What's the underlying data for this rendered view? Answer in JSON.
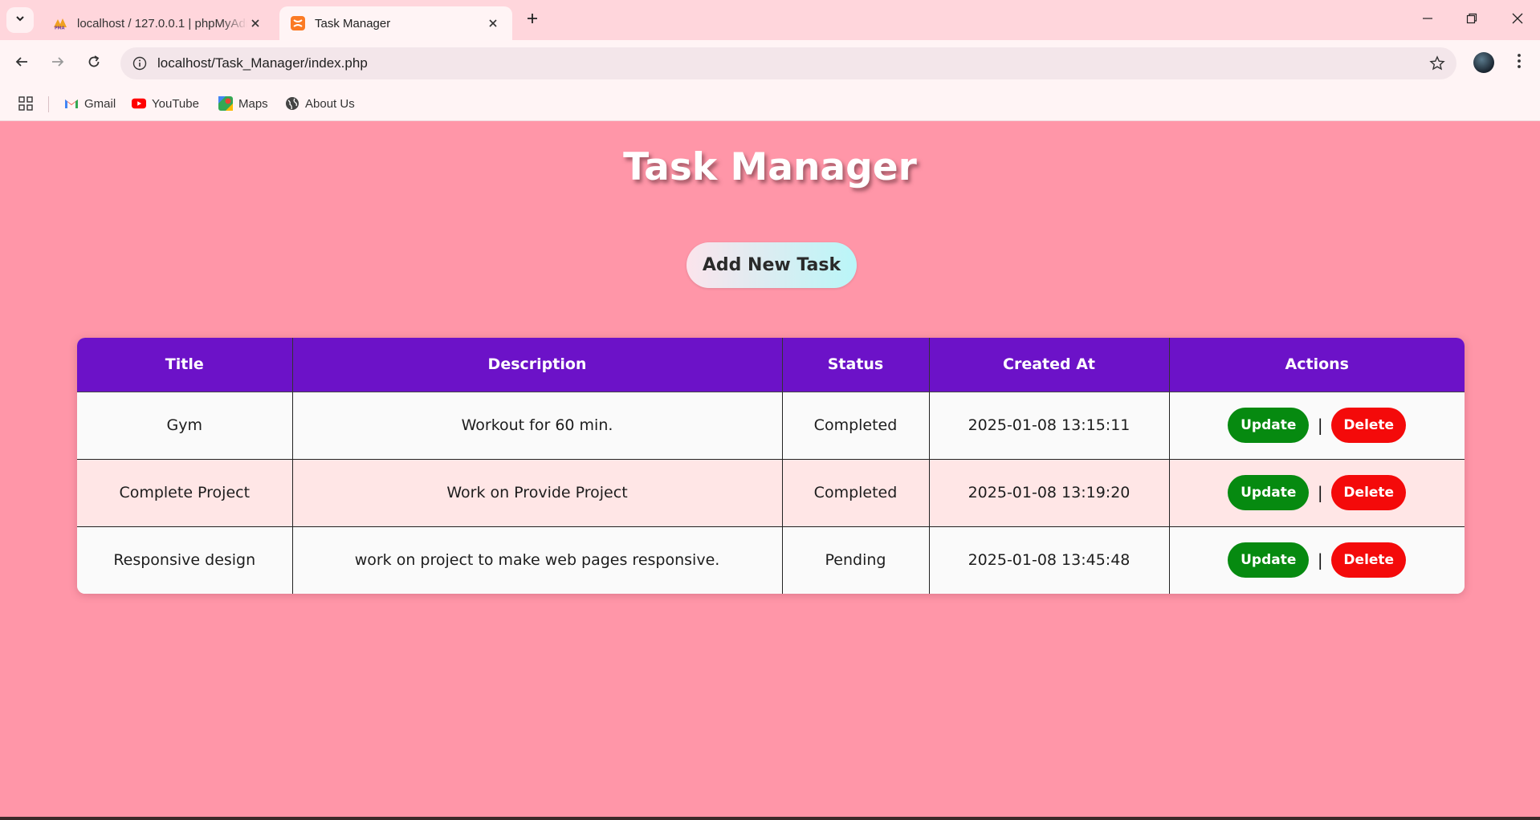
{
  "browser": {
    "tabs": [
      {
        "title": "localhost / 127.0.0.1 | phpMyAdmin",
        "active": false
      },
      {
        "title": "Task Manager",
        "active": true
      }
    ],
    "url": "localhost/Task_Manager/index.php",
    "bookmarks": [
      {
        "label": "Gmail",
        "icon": "gmail-icon"
      },
      {
        "label": "YouTube",
        "icon": "youtube-icon"
      },
      {
        "label": "Maps",
        "icon": "maps-icon"
      },
      {
        "label": "About Us",
        "icon": "globe-icon"
      }
    ]
  },
  "page": {
    "title": "Task Manager",
    "add_button": "Add New Task"
  },
  "table": {
    "headers": [
      "Title",
      "Description",
      "Status",
      "Created At",
      "Actions"
    ],
    "rows": [
      {
        "title": "Gym",
        "description": "Workout for 60 min.",
        "status": "Completed",
        "created_at": "2025-01-08 13:15:11"
      },
      {
        "title": "Complete Project",
        "description": "Work on Provide Project",
        "status": "Completed",
        "created_at": "2025-01-08 13:19:20"
      },
      {
        "title": "Responsive design",
        "description": "work on project to make web pages responsive.",
        "status": "Pending",
        "created_at": "2025-01-08 13:45:48"
      }
    ],
    "actions": {
      "update": "Update",
      "separator": "|",
      "delete": "Delete"
    }
  },
  "colors": {
    "page_background": "#ff96a8",
    "table_header": "#6c12c8",
    "update_button": "#068a10",
    "delete_button": "#f40a0a",
    "alt_row": "#ffe6e6"
  }
}
